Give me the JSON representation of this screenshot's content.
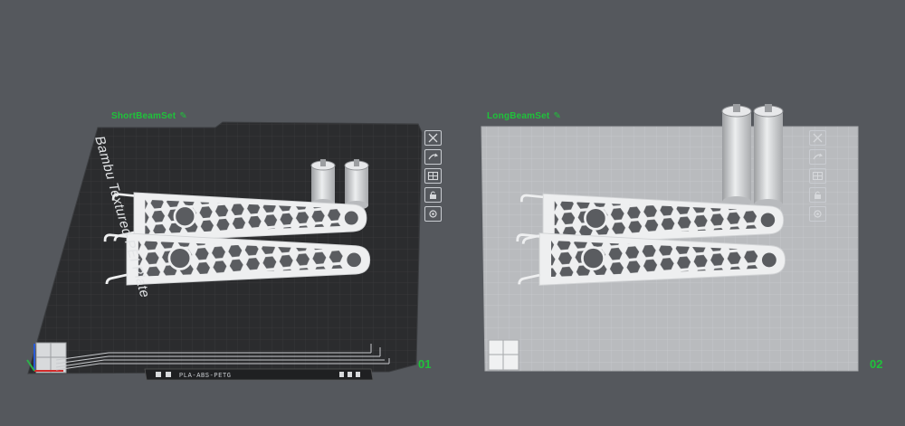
{
  "plates": [
    {
      "name": "ShortBeamSet",
      "number": "01",
      "bed_label": "Bambu Textured PEI Plate",
      "filament_tag": "PLA-ABS-PETG",
      "selected": true
    },
    {
      "name": "LongBeamSet",
      "number": "02",
      "selected": false
    }
  ],
  "icons": {
    "edit": "pencil-icon",
    "toolbar": [
      "close-icon",
      "camera-rotate-icon",
      "arrange-icon",
      "lock-icon",
      "settings-icon"
    ]
  },
  "colors": {
    "background": "#55585d",
    "accent_green": "#1fc23a",
    "dark_plate": "#2b2c2e",
    "light_plate": "#b9bbbe",
    "model": "#eeeff0"
  }
}
